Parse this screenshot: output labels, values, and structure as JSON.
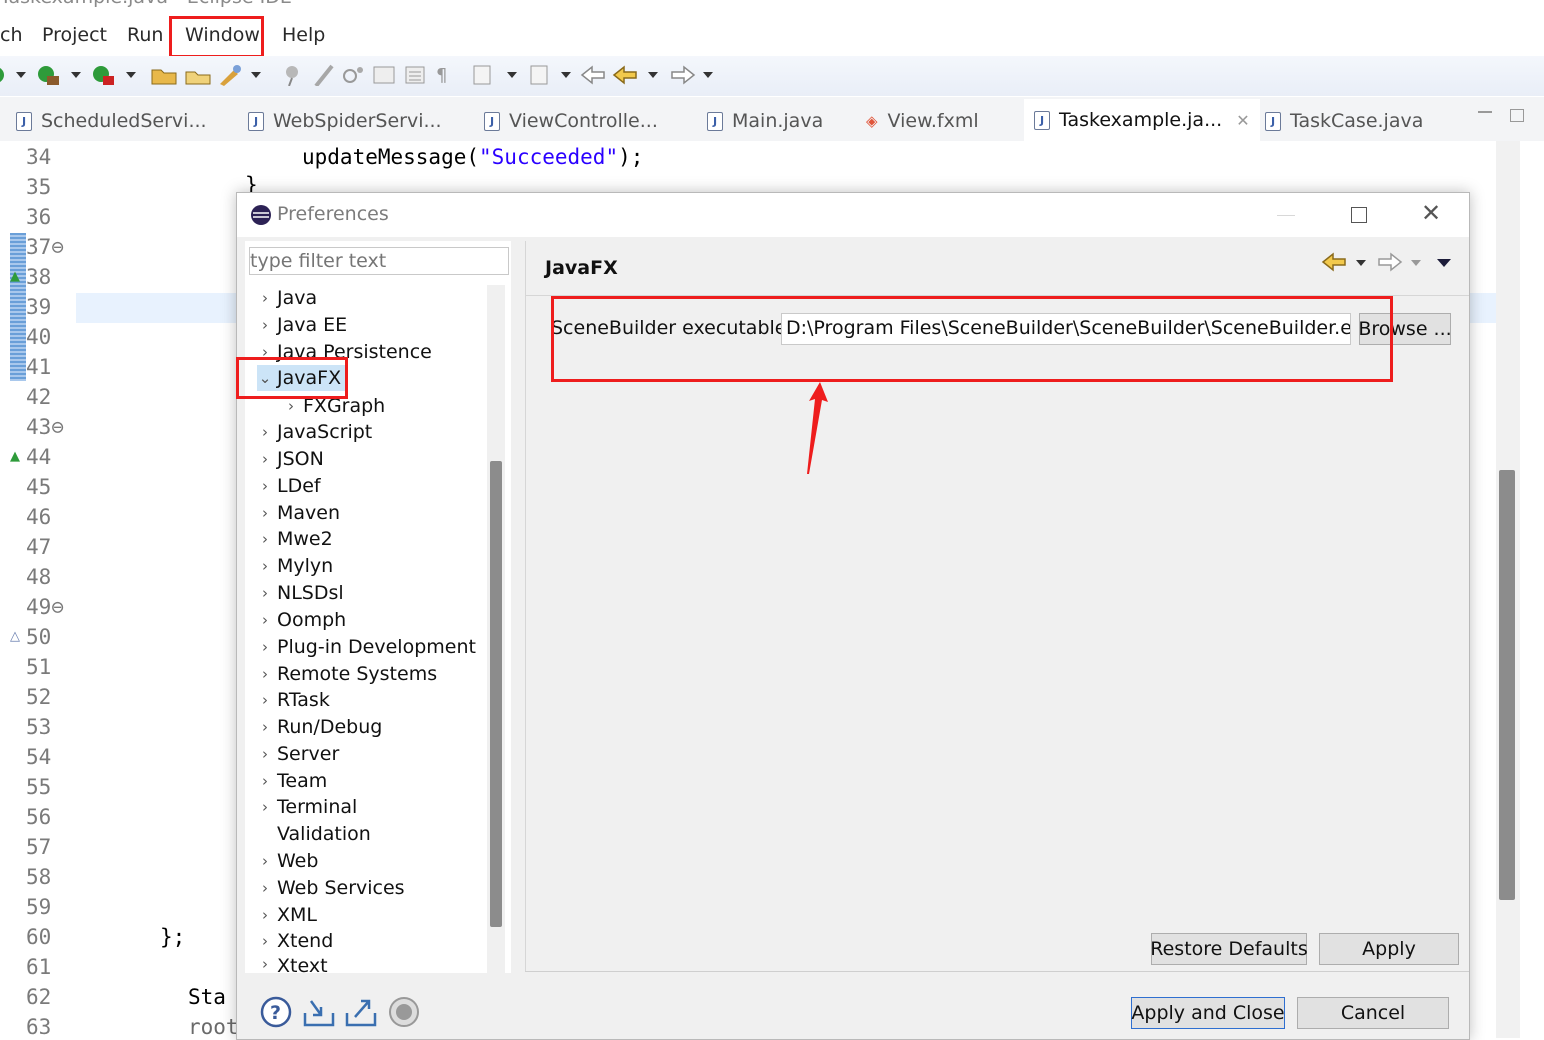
{
  "window": {
    "title": "Taskexample.java - Eclipse IDE"
  },
  "menubar": {
    "items": [
      "ch",
      "Project",
      "Run",
      "Window",
      "Help"
    ]
  },
  "toolbar": {
    "icons": [
      "run-icon",
      "debug-icon",
      "coverage-icon",
      "open-folder-icon",
      "open-file-icon",
      "tools-icon",
      "pin-icon",
      "brush-icon",
      "search-icon",
      "compare-icon",
      "list-icon",
      "pilcrow-icon",
      "annotation-icon",
      "nav-icon",
      "back-icon",
      "forward-icon"
    ]
  },
  "tabs": [
    {
      "label": "ScheduledServi..."
    },
    {
      "label": "WebSpiderServi..."
    },
    {
      "label": "ViewControlle..."
    },
    {
      "label": "Main.java"
    },
    {
      "label": "View.fxml"
    },
    {
      "label": "Taskexample.ja...",
      "active": true,
      "close": "✕"
    },
    {
      "label": "TaskCase.java"
    }
  ],
  "editor": {
    "line_numbers": [
      "34",
      "35",
      "36",
      "37⊖",
      "38",
      "39",
      "40",
      "41",
      "42",
      "43⊖",
      "44",
      "45",
      "46",
      "47",
      "48",
      "49⊖",
      "50",
      "51",
      "52",
      "53",
      "54",
      "55",
      "56",
      "57",
      "58",
      "59",
      "60",
      "61",
      "62",
      "63"
    ],
    "code": {
      "l34_pre": "updateMessage(",
      "l34_str": "\"Succeeded\"",
      "l34_post": ");",
      "l35": "}",
      "l60": "};",
      "l62": "Sta",
      "l63": "root"
    }
  },
  "dialog": {
    "title": "Preferences",
    "filter_placeholder": "type filter text",
    "tree": [
      {
        "label": "Java",
        "chev": "›"
      },
      {
        "label": "Java EE",
        "chev": "›"
      },
      {
        "label": "Java Persistence",
        "chev": "›"
      },
      {
        "label": "JavaFX",
        "chev": "⌄",
        "selected": true
      },
      {
        "label": "FXGraph",
        "chev": "›",
        "indent": 1
      },
      {
        "label": "JavaScript",
        "chev": "›"
      },
      {
        "label": "JSON",
        "chev": "›"
      },
      {
        "label": "LDef",
        "chev": "›"
      },
      {
        "label": "Maven",
        "chev": "›"
      },
      {
        "label": "Mwe2",
        "chev": "›"
      },
      {
        "label": "Mylyn",
        "chev": "›"
      },
      {
        "label": "NLSDsl",
        "chev": "›"
      },
      {
        "label": "Oomph",
        "chev": "›"
      },
      {
        "label": "Plug-in Development",
        "chev": "›"
      },
      {
        "label": "Remote Systems",
        "chev": "›"
      },
      {
        "label": "RTask",
        "chev": "›"
      },
      {
        "label": "Run/Debug",
        "chev": "›"
      },
      {
        "label": "Server",
        "chev": "›"
      },
      {
        "label": "Team",
        "chev": "›"
      },
      {
        "label": "Terminal",
        "chev": "›"
      },
      {
        "label": "Validation",
        "chev": ""
      },
      {
        "label": "Web",
        "chev": "›"
      },
      {
        "label": "Web Services",
        "chev": "›"
      },
      {
        "label": "XML",
        "chev": "›"
      },
      {
        "label": "Xtend",
        "chev": "›"
      },
      {
        "label": "Xtext",
        "chev": "›"
      }
    ],
    "page_title": "JavaFX",
    "scenebuilder_label": "SceneBuilder executable",
    "scenebuilder_path": "D:\\Program Files\\SceneBuilder\\SceneBuilder\\SceneBuilder.exe",
    "browse_label": "Browse ...",
    "restore_defaults_label": "Restore Defaults",
    "apply_label": "Apply",
    "apply_close_label": "Apply and Close",
    "cancel_label": "Cancel",
    "annotation_color": "#ee1d1d"
  }
}
